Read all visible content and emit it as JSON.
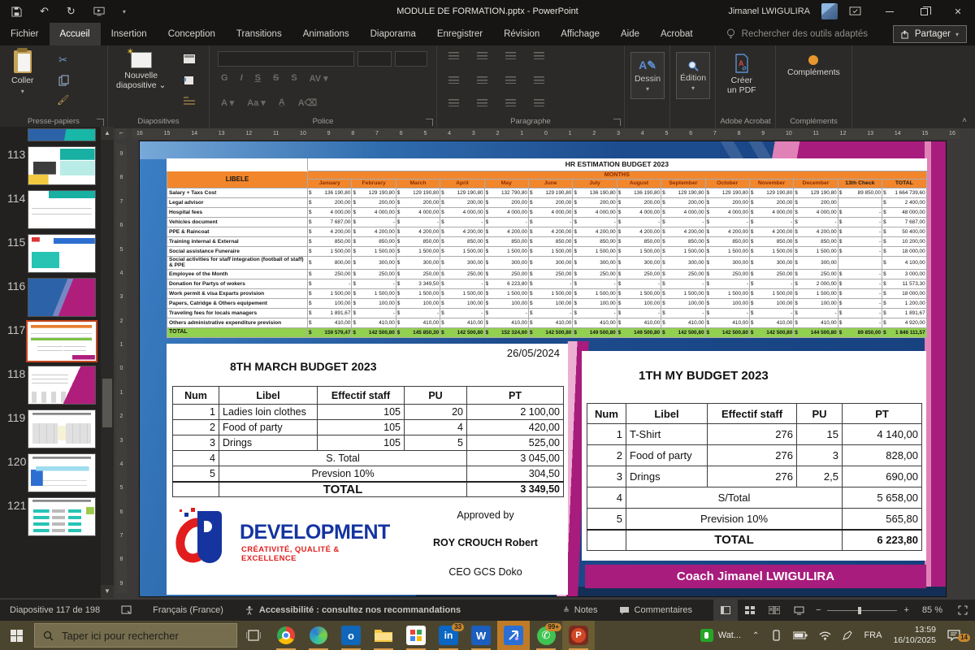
{
  "title_bar": {
    "title": "MODULE DE FORMATION.pptx  -  PowerPoint",
    "user_name": "Jimanel LWIGULIRA"
  },
  "tabs": {
    "items": [
      "Fichier",
      "Accueil",
      "Insertion",
      "Conception",
      "Transitions",
      "Animations",
      "Diaporama",
      "Enregistrer",
      "Révision",
      "Affichage",
      "Aide",
      "Acrobat"
    ],
    "active": "Accueil",
    "search": "Rechercher des outils adaptés",
    "share": "Partager"
  },
  "ribbon": {
    "paste": "Coller",
    "new_slide": "Nouvelle\ndiapositive ⌄",
    "draw": "Dessin",
    "edit": "Édition",
    "create_pdf": "Créer\nun PDF",
    "addins": "Compléments",
    "groups": {
      "clipboard": "Presse-papiers",
      "slides": "Diapositives",
      "font": "Police",
      "paragraph": "Paragraphe",
      "acrobat": "Adobe Acrobat",
      "addins": "Compléments"
    }
  },
  "rulers": {
    "horizontal": "16 15 14 13 12 11 10 9 8 7 6 5 4 3 2 1 0 1 2 3 4 5 6 7 8 9 10 11 12 13 14 15 16",
    "vertical": "9 8 7 6 5 4 3 2 1 0 1 2 3 4 5 6 7 8 9"
  },
  "thumbnail_panel": {
    "slides": [
      {
        "num": "",
        "style": "sliver",
        "selected": false
      },
      {
        "num": "113",
        "style": "teal",
        "selected": false
      },
      {
        "num": "114",
        "style": "table",
        "selected": false
      },
      {
        "num": "115",
        "style": "bluehead",
        "selected": false
      },
      {
        "num": "116",
        "style": "magenta",
        "selected": false
      },
      {
        "num": "117",
        "style": "budget",
        "selected": true
      },
      {
        "num": "118",
        "style": "budget2",
        "selected": false
      },
      {
        "num": "119",
        "style": "calendar",
        "selected": false
      },
      {
        "num": "120",
        "style": "timeline",
        "selected": false
      },
      {
        "num": "121",
        "style": "lists",
        "selected": false
      }
    ]
  },
  "slide": {
    "date": "26/05/2024",
    "hr_table": {
      "title": "HR ESTIMATION BUDGET 2023",
      "label_header": "LIBELE",
      "months_header": "MONTHS",
      "currency": "$",
      "columns": [
        "January",
        "February",
        "March",
        "April",
        "May",
        "June",
        "July",
        "August",
        "September",
        "October",
        "November",
        "December",
        "13th Check",
        "TOTAL"
      ],
      "rows": [
        {
          "label": "Salary + Taxs Cost",
          "values": [
            "136 190,80",
            "129 190,80",
            "129 190,80",
            "129 190,80",
            "132 790,80",
            "129 190,80",
            "136 190,80",
            "136 190,80",
            "129 190,80",
            "129 190,80",
            "129 190,80",
            "129 190,80",
            "89 850,00",
            "1 664 739,60"
          ]
        },
        {
          "label": "Legal advisor",
          "values": [
            "200,00",
            "200,00",
            "200,00",
            "200,00",
            "200,00",
            "200,00",
            "200,00",
            "200,00",
            "200,00",
            "200,00",
            "200,00",
            "200,00",
            "",
            "2 400,00"
          ]
        },
        {
          "label": "Hospital fees",
          "values": [
            "4 000,00",
            "4 000,00",
            "4 000,00",
            "4 000,00",
            "4 000,00",
            "4 000,00",
            "4 000,00",
            "4 000,00",
            "4 000,00",
            "4 000,00",
            "4 000,00",
            "4 000,00",
            "-",
            "48 000,00"
          ]
        },
        {
          "label": "Vehicles document",
          "values": [
            "7 687,00",
            "-",
            "-",
            "-",
            "-",
            "-",
            "-",
            "-",
            "-",
            "-",
            "-",
            "-",
            "-",
            "7 687,00"
          ]
        },
        {
          "label": "PPE & Raincoat",
          "values": [
            "4 200,00",
            "4 200,00",
            "4 200,00",
            "4 200,00",
            "4 200,00",
            "4 200,00",
            "4 200,00",
            "4 200,00",
            "4 200,00",
            "4 200,00",
            "4 200,00",
            "4 200,00",
            "-",
            "50 400,00"
          ]
        },
        {
          "label": "Training internal & External",
          "values": [
            "850,00",
            "850,00",
            "850,00",
            "850,00",
            "850,00",
            "850,00",
            "850,00",
            "850,00",
            "850,00",
            "850,00",
            "850,00",
            "850,00",
            "-",
            "10 200,00"
          ]
        },
        {
          "label": "Social assistance Funeraire",
          "values": [
            "1 500,00",
            "1 500,00",
            "1 500,00",
            "1 500,00",
            "1 500,00",
            "1 500,00",
            "1 500,00",
            "1 500,00",
            "1 500,00",
            "1 500,00",
            "1 500,00",
            "1 500,00",
            "-",
            "18 000,00"
          ]
        },
        {
          "label": "Social activities for staff integration (football of staff) & PPE",
          "values": [
            "800,00",
            "300,00",
            "300,00",
            "300,00",
            "300,00",
            "300,00",
            "300,00",
            "300,00",
            "300,00",
            "300,00",
            "300,00",
            "300,00",
            "",
            "4 100,00"
          ]
        },
        {
          "label": "Employee of the Month",
          "values": [
            "250,00",
            "250,00",
            "250,00",
            "250,00",
            "250,00",
            "250,00",
            "250,00",
            "250,00",
            "250,00",
            "250,00",
            "250,00",
            "250,00",
            "-",
            "3 000,00"
          ]
        },
        {
          "label": "Donation for Partys of wokers",
          "values": [
            "-",
            "-",
            "3 349,50",
            "-",
            "6 223,80",
            "-",
            "-",
            "-",
            "-",
            "-",
            "-",
            "2 000,00",
            "-",
            "11 573,30"
          ]
        },
        {
          "label": "Work permit & visa Exparts provision",
          "values": [
            "1 500,00",
            "1 500,00",
            "1 500,00",
            "1 500,00",
            "1 500,00",
            "1 500,00",
            "1 500,00",
            "1 500,00",
            "1 500,00",
            "1 500,00",
            "1 500,00",
            "1 500,00",
            "-",
            "18 000,00"
          ]
        },
        {
          "label": "Papers, Catridge & Others equipement",
          "values": [
            "100,00",
            "100,00",
            "100,00",
            "100,00",
            "100,00",
            "100,00",
            "100,00",
            "100,00",
            "100,00",
            "100,00",
            "100,00",
            "100,00",
            "-",
            "1 200,00"
          ]
        },
        {
          "label": "Traveling fees for locals managers",
          "values": [
            "1 891,67",
            "-",
            "-",
            "-",
            "-",
            "-",
            "-",
            "-",
            "-",
            "-",
            "-",
            "-",
            "-",
            "1 891,67"
          ]
        },
        {
          "label": "Others administrative expenditure prevision",
          "values": [
            "410,00",
            "410,00",
            "410,00",
            "410,00",
            "410,00",
            "410,00",
            "410,00",
            "410,00",
            "410,00",
            "410,00",
            "410,00",
            "410,00",
            "-",
            "4 920,00"
          ]
        }
      ],
      "total_row": {
        "label": "TOTAL",
        "values": [
          "159 579,47",
          "142 500,80",
          "145 850,30",
          "142 500,80",
          "152 324,60",
          "142 500,80",
          "149 500,80",
          "149 500,80",
          "142 500,80",
          "142 500,80",
          "142 500,80",
          "144 500,80",
          "89 850,00",
          "1 846 111,57"
        ]
      }
    },
    "march_budget": {
      "title": "8TH MARCH BUDGET  2023",
      "headers": [
        "Num",
        "Libel",
        "Effectif staff",
        "PU",
        "PT"
      ],
      "rows": [
        [
          "1",
          "Ladies loin clothes",
          "105",
          "20",
          "2 100,00"
        ],
        [
          "2",
          "Food of party",
          "105",
          "4",
          "420,00"
        ],
        [
          "3",
          "Drings",
          "105",
          "5",
          "525,00"
        ]
      ],
      "subtotal": {
        "num": "4",
        "label": "S. Total",
        "value": "3 045,00"
      },
      "prevision": {
        "num": "5",
        "label": "Prevsion 10%",
        "value": "304,50"
      },
      "total": {
        "label": "TOTAL",
        "value": "3 349,50"
      }
    },
    "my_budget": {
      "title": "1TH MY BUDGET  2023",
      "headers": [
        "Num",
        "Libel",
        "Effectif staff",
        "PU",
        "PT"
      ],
      "rows": [
        [
          "1",
          "T-Shirt",
          "276",
          "15",
          "4 140,00"
        ],
        [
          "2",
          "Food of party",
          "276",
          "3",
          "828,00"
        ],
        [
          "3",
          "Drings",
          "276",
          "2,5",
          "690,00"
        ]
      ],
      "subtotal": {
        "num": "4",
        "label": "S/Total",
        "value": "5 658,00"
      },
      "prevision": {
        "num": "5",
        "label": "Prevision 10%",
        "value": "565,80"
      },
      "total": {
        "label": "TOTAL",
        "value": "6 223,80"
      }
    },
    "logo": {
      "brand": "DEVELOPMENT",
      "tagline": "CRÉATIVITÉ, QUALITÉ & EXCELLENCE"
    },
    "approval": {
      "line1": "Approved by",
      "line2": "ROY CROUCH Robert",
      "line3": "CEO GCS Doko"
    },
    "coach_banner": "Coach Jimanel LWIGULIRA"
  },
  "status_bar": {
    "slide_counter": "Diapositive 117 de 198",
    "language": "Français (France)",
    "accessibility": "Accessibilité : consultez nos recommandations",
    "notes": "Notes",
    "comments": "Commentaires",
    "zoom_level": "85 %"
  },
  "taskbar": {
    "search_placeholder": "Taper ici pour rechercher",
    "tray_app": "Wat...",
    "language": "FRA",
    "time": "13:59",
    "date": "16/10/2025",
    "badges": {
      "linkedin": "33",
      "whatsapp": "99+",
      "notifications": "14"
    }
  }
}
